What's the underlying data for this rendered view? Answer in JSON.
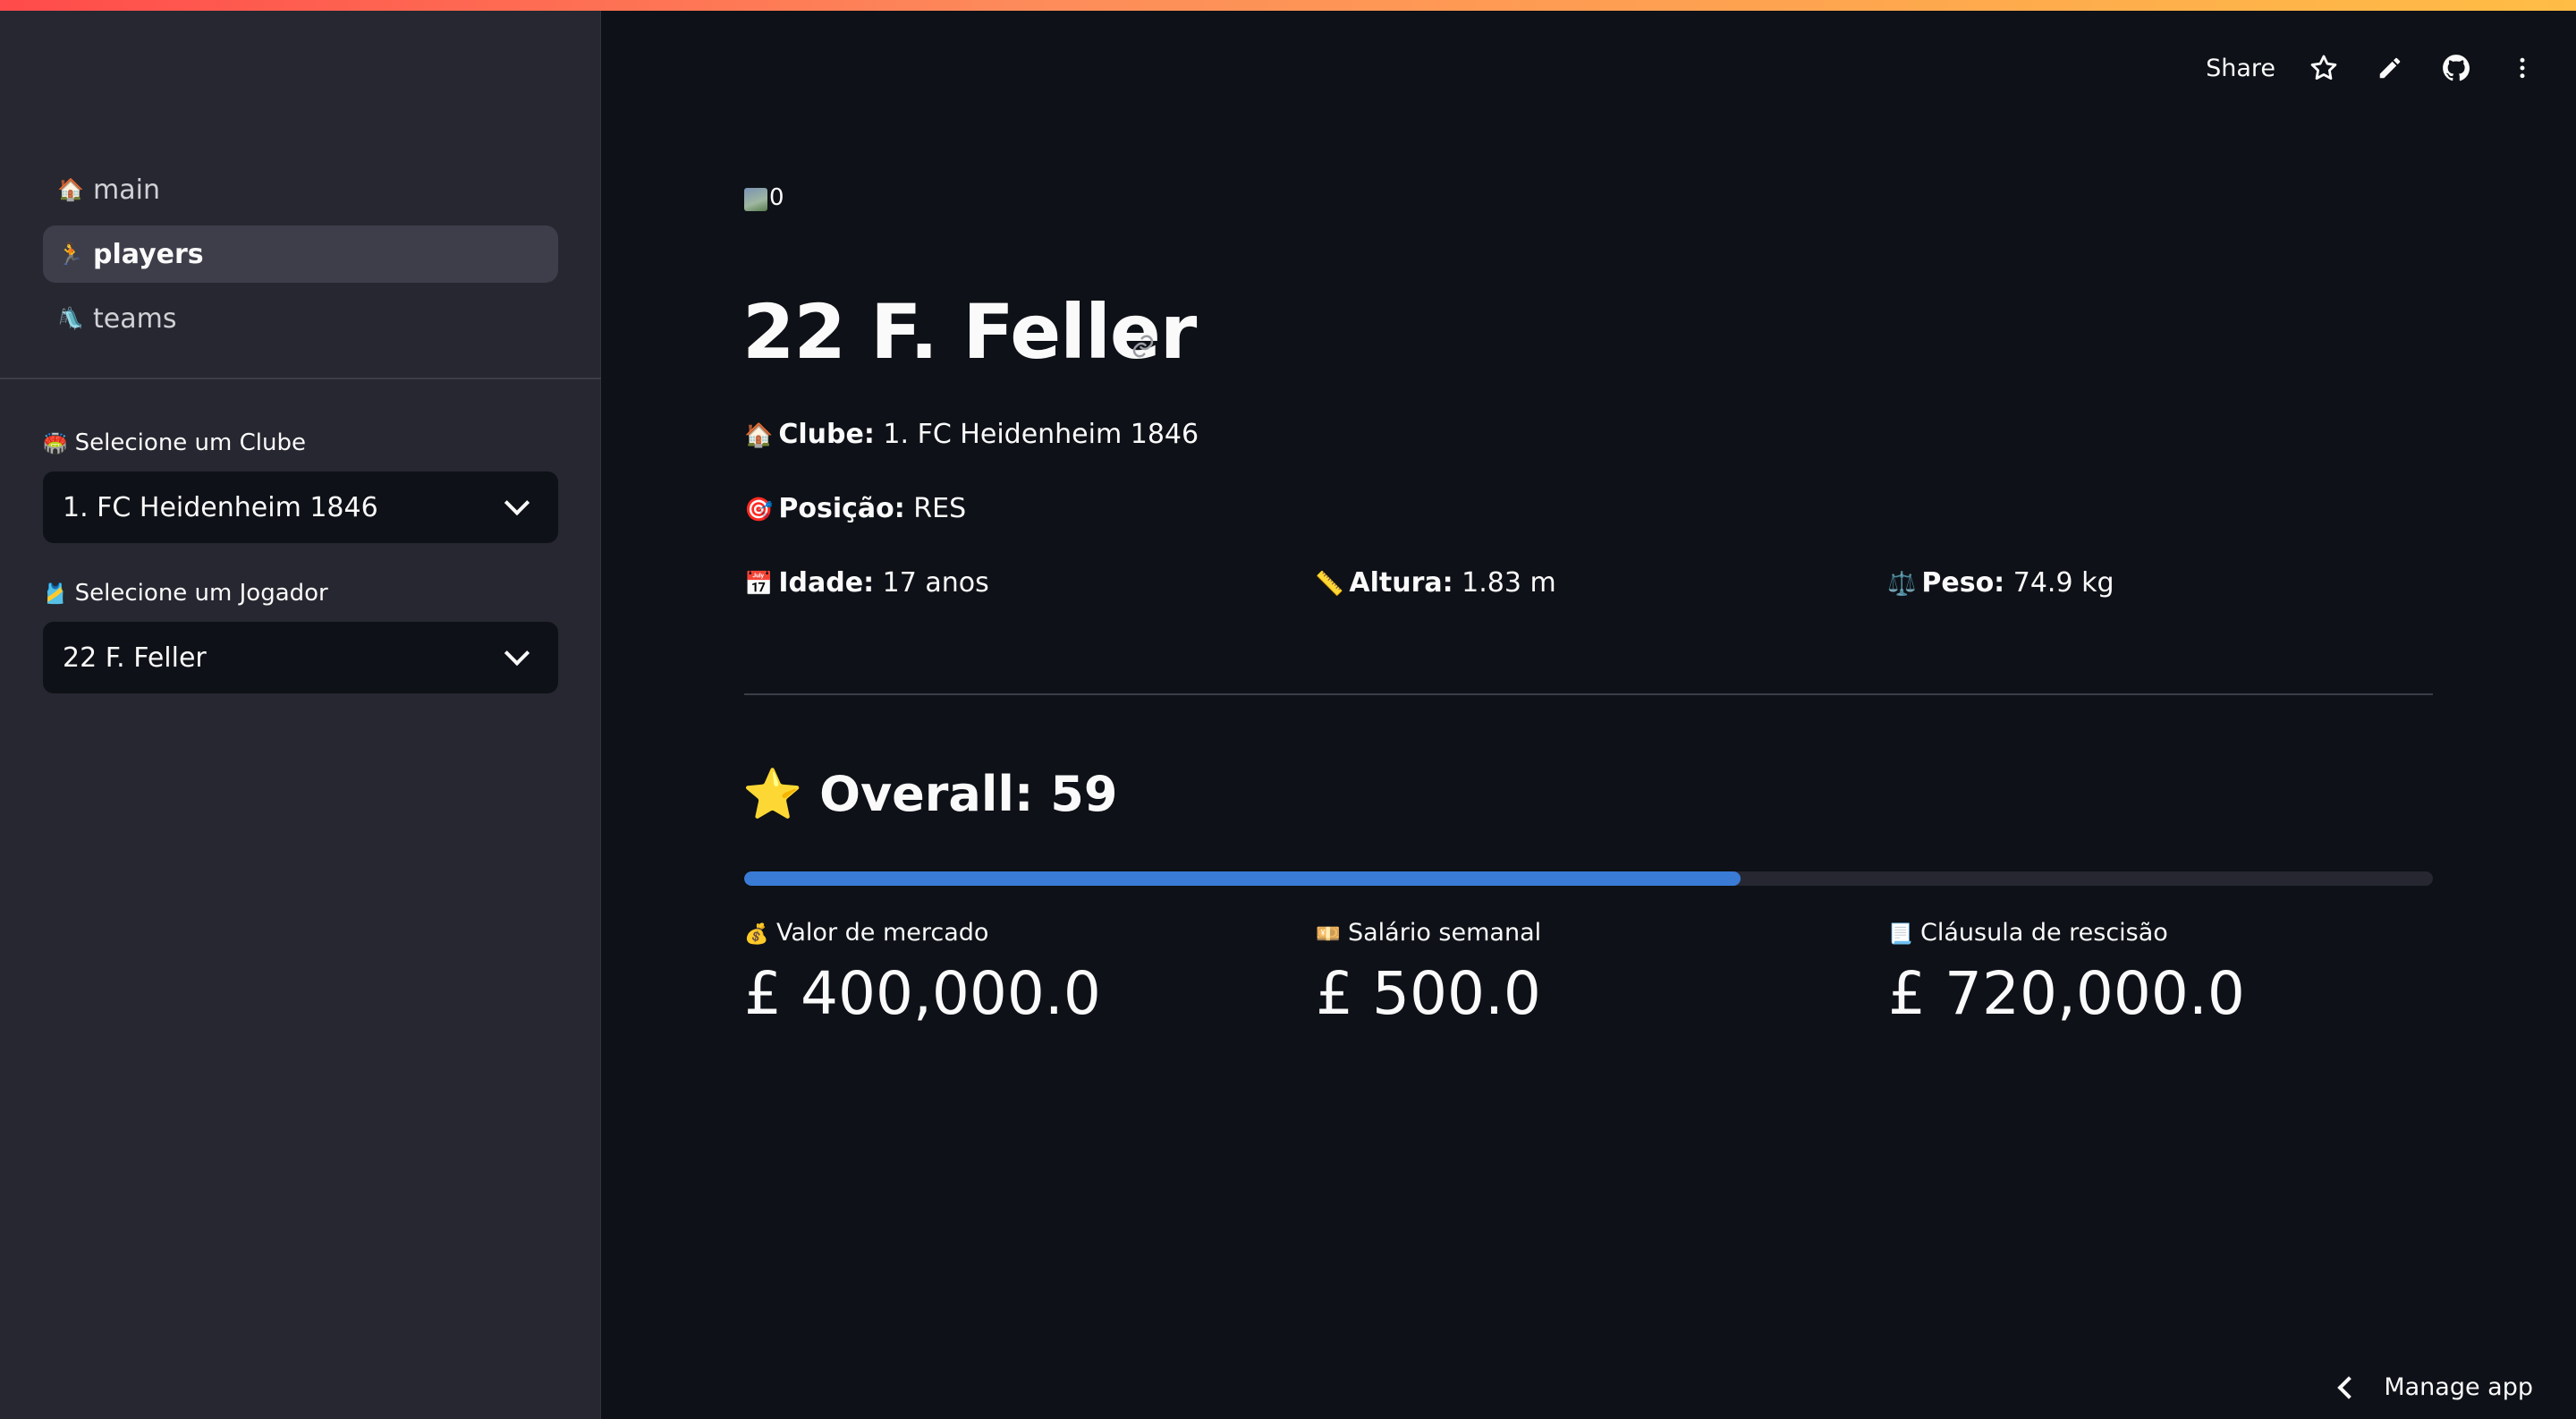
{
  "sidebar": {
    "nav": [
      {
        "icon": "🏠",
        "label": "main",
        "active": false
      },
      {
        "icon": "🏃",
        "label": "players",
        "active": true
      },
      {
        "icon": "🛝",
        "label": "teams",
        "active": false
      }
    ],
    "club_select": {
      "label_icon": "🏟️",
      "label": "Selecione um Clube",
      "value": "1. FC Heidenheim 1846"
    },
    "player_select": {
      "label_icon": "🎽",
      "label": "Selecione um Jogador",
      "value": "22 F. Feller"
    }
  },
  "toolbar": {
    "share_label": "Share",
    "icons": [
      "star-icon",
      "pencil-icon",
      "github-icon",
      "more-vertical-icon"
    ]
  },
  "main": {
    "image_alt": "0",
    "title": "22 F. Feller",
    "club": {
      "icon": "🏠",
      "label": "Clube:",
      "value": "1. FC Heidenheim 1846"
    },
    "position": {
      "icon": "🎯",
      "label": "Posição:",
      "value": "RES"
    },
    "age": {
      "icon": "📅",
      "label": "Idade:",
      "value": "17 anos"
    },
    "height": {
      "icon": "📏",
      "label": "Altura:",
      "value": "1.83 m"
    },
    "weight": {
      "icon": "⚖️",
      "label": "Peso:",
      "value": "74.9 kg"
    },
    "overall": {
      "icon": "⭐",
      "text": "Overall: 59",
      "progress_fraction": 0.59
    },
    "metrics": [
      {
        "icon": "💰",
        "label": "Valor de mercado",
        "value": "£ 400,000.0"
      },
      {
        "icon": "💴",
        "label": "Salário semanal",
        "value": "£ 500.0"
      },
      {
        "icon": "📃",
        "label": "Cláusula de rescisão",
        "value": "£ 720,000.0"
      }
    ]
  },
  "footer": {
    "manage_label": "Manage app"
  },
  "colors": {
    "background": "#0e1117",
    "sidebar": "#262730",
    "progress": "#3a7bd5"
  }
}
